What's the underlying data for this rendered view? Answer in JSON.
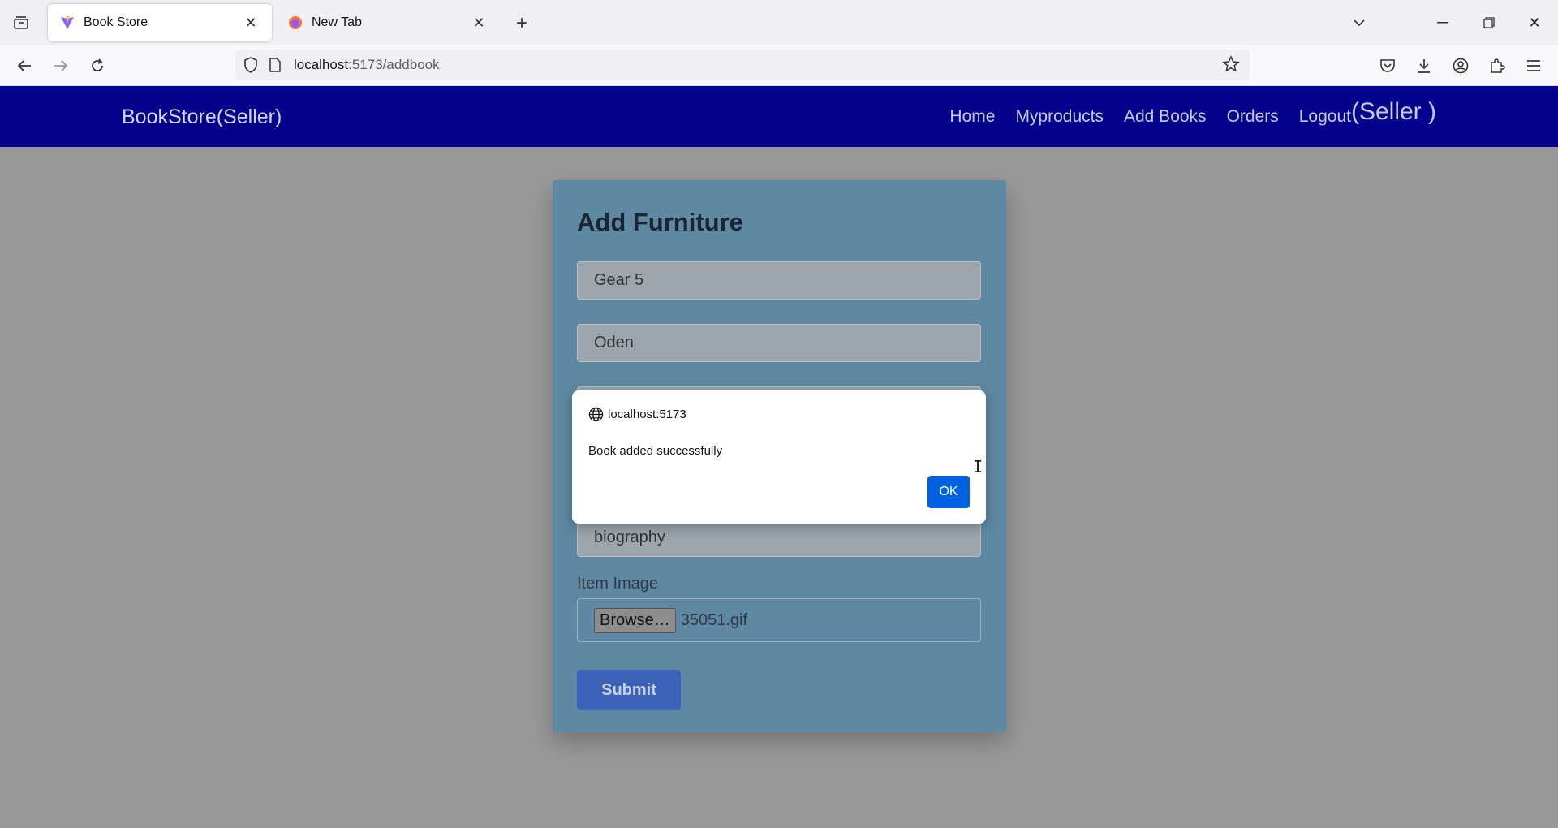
{
  "browser": {
    "tabs": [
      {
        "title": "Book Store",
        "favicon": "vite-logo-icon",
        "active": true
      },
      {
        "title": "New Tab",
        "favicon": "firefox-logo-icon",
        "active": false
      }
    ],
    "url_host": "localhost",
    "url_path": ":5173/addbook"
  },
  "site": {
    "brand": "BookStore(Seller)",
    "nav": {
      "home": "Home",
      "myproducts": "Myproducts",
      "add_books": "Add Books",
      "orders": "Orders",
      "logout": "Logout",
      "role": "(Seller )"
    },
    "colors": {
      "header_bg": "#02028c",
      "card_bg": "#5f88a3",
      "submit_bg": "#3a63b8",
      "ok_bg": "#0061e0"
    }
  },
  "form": {
    "title": "Add Furniture",
    "fields": {
      "field1": "Gear 5",
      "field2": "Oden",
      "genre": "biography"
    },
    "image_label": "Item Image",
    "browse_label": "Browse…",
    "file_name": "35051.gif",
    "submit_label": "Submit"
  },
  "dialog": {
    "origin": "localhost:5173",
    "message": "Book added successfully",
    "ok_label": "OK"
  }
}
